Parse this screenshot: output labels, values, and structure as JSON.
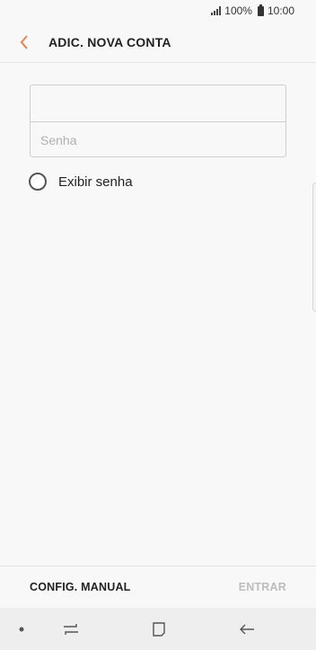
{
  "status_bar": {
    "battery": "100%",
    "time": "10:00"
  },
  "header": {
    "title": "ADIC. NOVA CONTA"
  },
  "form": {
    "email_value": "",
    "password_placeholder": "Senha",
    "show_password_label": "Exibir senha"
  },
  "footer": {
    "manual_label": "CONFIG. MANUAL",
    "enter_label": "ENTRAR"
  },
  "colors": {
    "accent": "#e8825a",
    "disabled": "#bdbdbd"
  },
  "icons": [
    "signal-icon",
    "battery-icon",
    "back-arrow-icon",
    "nav-dot-icon",
    "recents-icon",
    "home-icon",
    "nav-back-icon"
  ]
}
